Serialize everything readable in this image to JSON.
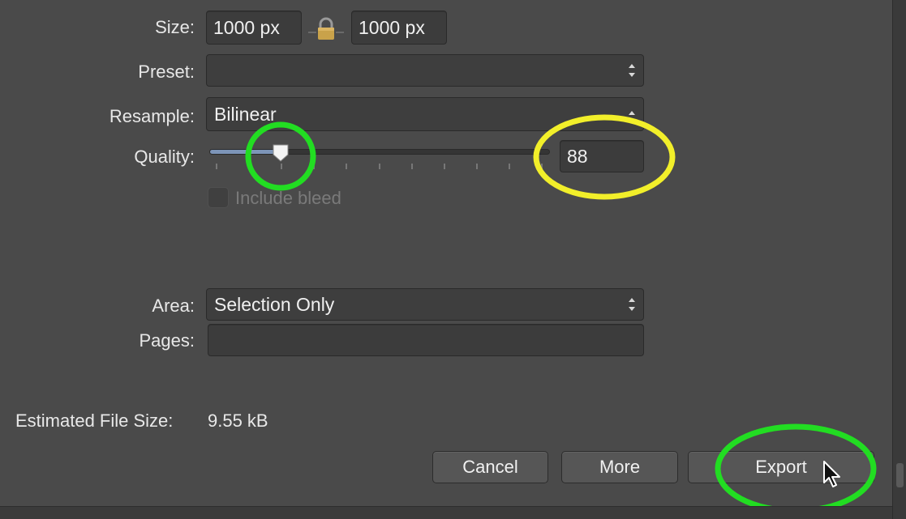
{
  "size": {
    "label": "Size:",
    "width_value": "1000 px",
    "height_value": "1000 px"
  },
  "preset": {
    "label": "Preset:",
    "value": ""
  },
  "resample": {
    "label": "Resample:",
    "value": "Bilinear"
  },
  "quality": {
    "label": "Quality:",
    "value": "88",
    "slider_fraction": 0.21
  },
  "include_bleed": {
    "label": "Include bleed",
    "checked": false
  },
  "area": {
    "label": "Area:",
    "value": "Selection Only"
  },
  "pages": {
    "label": "Pages:",
    "value": ""
  },
  "file_size": {
    "label": "Estimated File Size:",
    "value": "9.55 kB"
  },
  "buttons": {
    "cancel": "Cancel",
    "more": "More",
    "export": "Export"
  },
  "annotation_colors": {
    "green": "#22dd22",
    "yellow": "#f2ef2a"
  },
  "icons": {
    "lock": "padlock-icon",
    "stepper": "up-down-arrows-icon",
    "cursor": "mouse-pointer-icon"
  }
}
